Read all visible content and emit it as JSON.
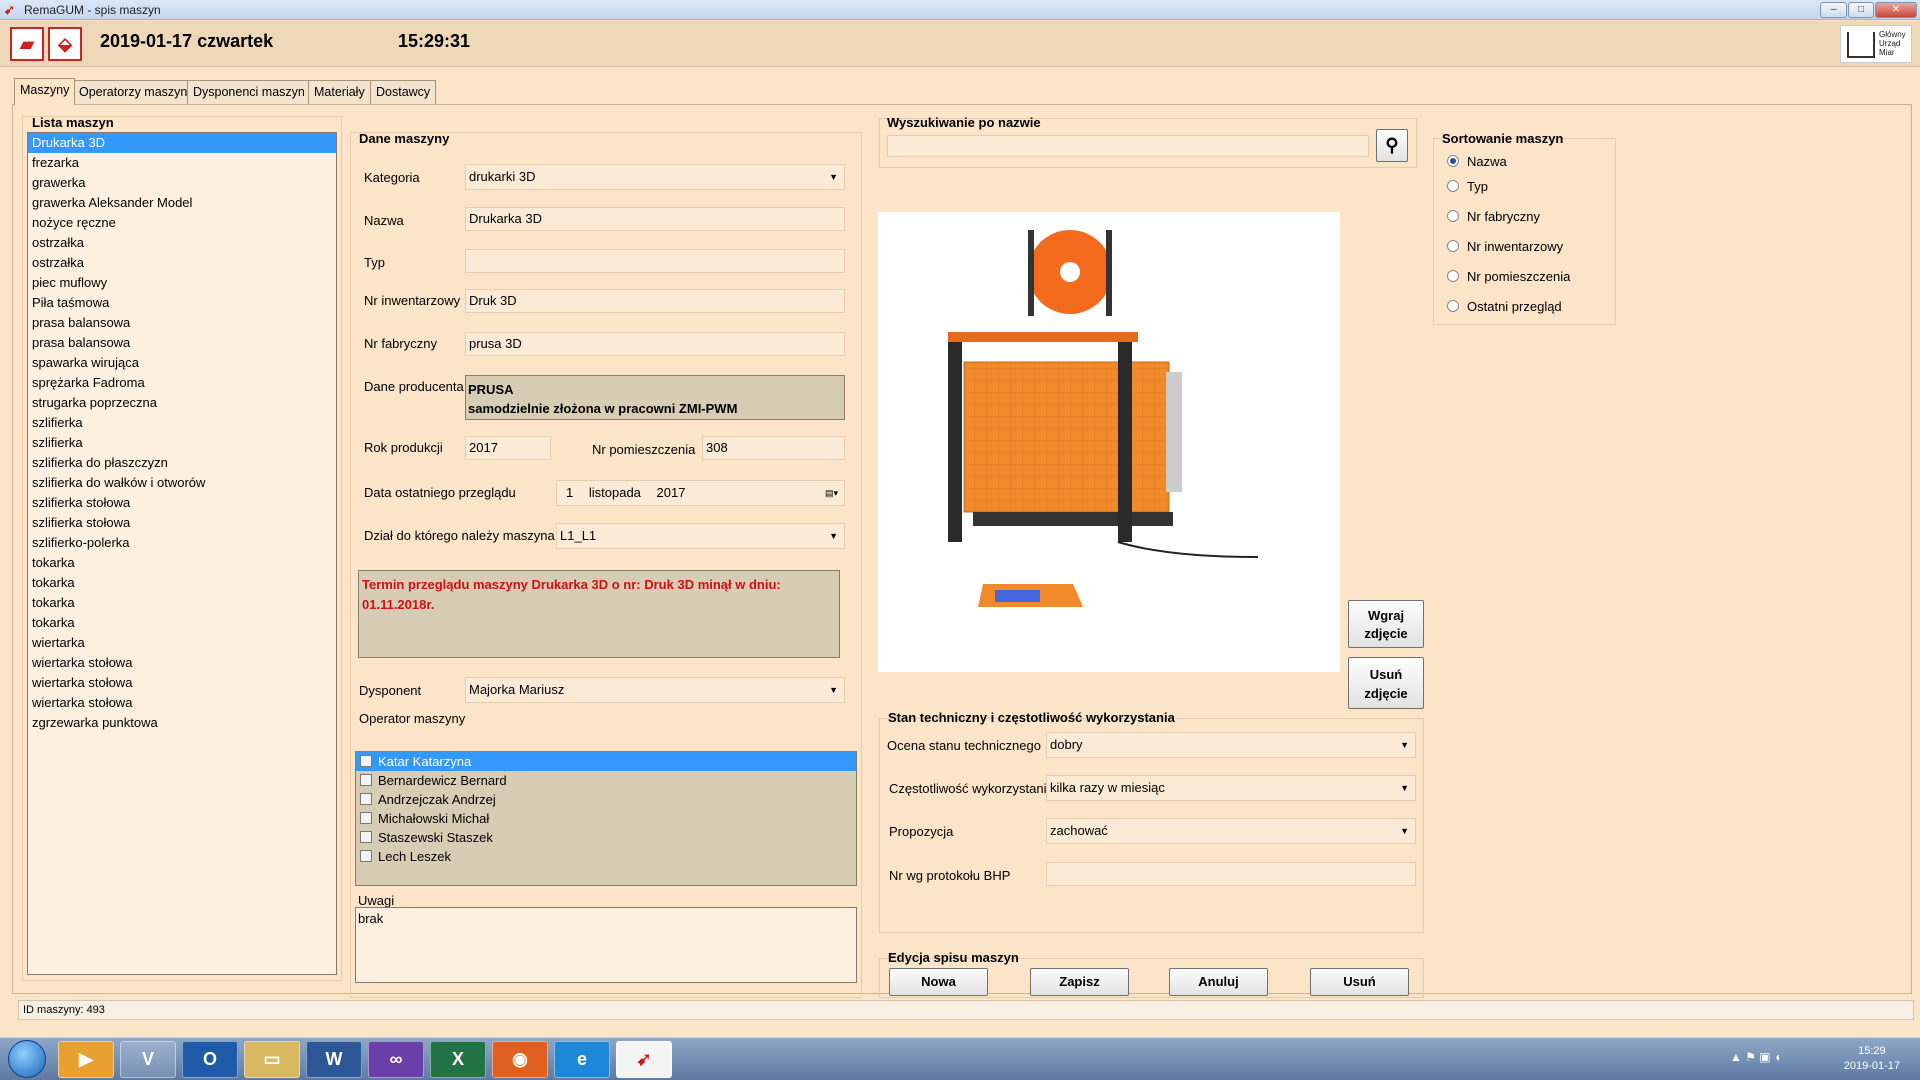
{
  "window": {
    "title": "RemaGUM - spis maszyn",
    "buttons": [
      "–",
      "□",
      "✕"
    ]
  },
  "header": {
    "date": "2019-01-17 czwartek",
    "time": "15:29:31",
    "logo_text": [
      "Główny",
      "Urząd",
      "Miar"
    ]
  },
  "tabs": [
    "Maszyny",
    "Operatorzy maszyn",
    "Dysponenci maszyn",
    "Materiały",
    "Dostawcy"
  ],
  "list": {
    "label": "Lista maszyn",
    "items": [
      "Drukarka 3D",
      "frezarka",
      "grawerka",
      "grawerka Aleksander Model",
      "nożyce ręczne",
      "ostrzałka",
      "ostrzałka",
      "piec muflowy",
      "Piła taśmowa",
      "prasa balansowa",
      "prasa balansowa",
      "spawarka wirująca",
      "sprężarka Fadroma",
      "strugarka poprzeczna",
      "szlifierka",
      "szlifierka",
      "szlifierka do płaszczyzn",
      "szlifierka do wałków i otworów",
      "szlifierka stołowa",
      "szlifierka stołowa",
      "szlifierko-polerka",
      "tokarka",
      "tokarka",
      "tokarka",
      "tokarka",
      "wiertarka",
      "wiertarka stołowa",
      "wiertarka stołowa",
      "wiertarka stołowa",
      "zgrzewarka punktowa"
    ],
    "selected_index": 0
  },
  "machine": {
    "group_label": "Dane maszyny",
    "category_label": "Kategoria",
    "category_value": "drukarki 3D",
    "name_label": "Nazwa",
    "name_value": "Drukarka 3D",
    "type_label": "Typ",
    "type_value": "",
    "inventory_label": "Nr inwentarzowy",
    "inventory_value": "Druk 3D",
    "serial_label": "Nr fabryczny",
    "serial_value": "prusa 3D",
    "producer_label": "Dane producenta",
    "producer_line1": "PRUSA",
    "producer_line2": "samodzielnie złożona w pracowni ZMI-PWM",
    "year_label": "Rok produkcji",
    "year_value": "2017",
    "room_label": "Nr pomieszczenia",
    "room_value": "308",
    "review_label": "Data ostatniego przeglądu",
    "review_day": "1",
    "review_month": "listopada",
    "review_year": "2017",
    "dept_label": "Dział do którego należy maszyna",
    "dept_value": "L1_L1",
    "warning": "Termin przeglądu maszyny Drukarka 3D o nr: Druk 3D minął w dniu: 01.11.2018r.",
    "disposer_label": "Dysponent",
    "disposer_value": "Majorka Mariusz",
    "operator_label": "Operator maszyny",
    "operators": [
      "Katar Katarzyna",
      "Bernardewicz Bernard",
      "Andrzejczak Andrzej",
      "Michałowski Michał",
      "Staszewski Staszek",
      "Lech Leszek"
    ],
    "notes_label": "Uwagi",
    "notes_value": "brak"
  },
  "search": {
    "label": "Wyszukiwanie po nazwie",
    "value": ""
  },
  "photo_buttons": {
    "upload": [
      "Wgraj",
      "zdjęcie"
    ],
    "remove": [
      "Usuń",
      "zdjęcie"
    ]
  },
  "sort": {
    "label": "Sortowanie maszyn",
    "options": [
      "Nazwa",
      "Typ",
      "Nr fabryczny",
      "Nr inwentarzowy",
      "Nr pomieszczenia",
      "Ostatni przegląd"
    ],
    "selected_index": 0
  },
  "tech": {
    "group_label": "Stan techniczny i częstotliwość wykorzystania",
    "condition_label": "Ocena stanu technicznego",
    "condition_value": "dobry",
    "frequency_label": "Częstotliwość wykorzystania",
    "frequency_value": "kilka razy w miesiąc",
    "proposal_label": "Propozycja",
    "proposal_value": "zachować",
    "bhp_label": "Nr wg protokołu BHP",
    "bhp_value": ""
  },
  "edit": {
    "group_label": "Edycja spisu maszyn",
    "new": "Nowa",
    "save": "Zapisz",
    "cancel": "Anuluj",
    "delete": "Usuń"
  },
  "status": {
    "text": "ID maszyny:  493"
  },
  "taskbar": {
    "time": "15:29",
    "date": "2019-01-17"
  },
  "colors": {
    "background": "#fbe4c8",
    "selection": "#3399ff",
    "warning": "#d01010",
    "panel": "#d7cdb4"
  }
}
